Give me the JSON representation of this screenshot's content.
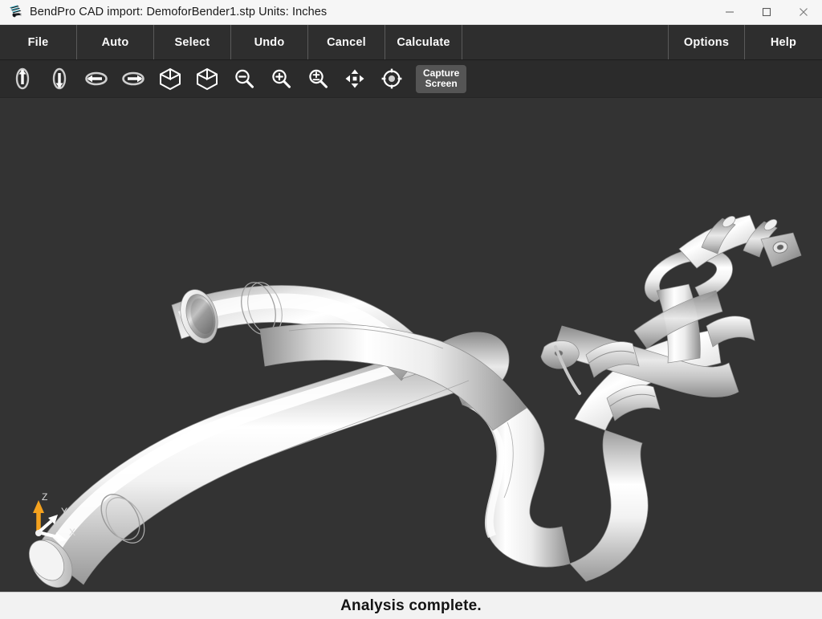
{
  "window": {
    "app_icon": "pipe-logo-icon",
    "title": "BendPro CAD import: DemoforBender1.stp  Units: Inches",
    "app_name": "BendPro",
    "document_name": "DemoforBender1.stp",
    "units_label": "Units: Inches",
    "controls": [
      {
        "name": "minimize",
        "icon": "minimize-icon",
        "glyph": "—"
      },
      {
        "name": "maximize",
        "icon": "maximize-icon",
        "glyph": "☐"
      },
      {
        "name": "close",
        "icon": "close-icon",
        "glyph": "✕"
      }
    ]
  },
  "menubar": {
    "left_items": [
      {
        "label": "File",
        "name": "file"
      },
      {
        "label": "Auto",
        "name": "auto"
      },
      {
        "label": "Select",
        "name": "select"
      },
      {
        "label": "Undo",
        "name": "undo"
      },
      {
        "label": "Cancel",
        "name": "cancel"
      },
      {
        "label": "Calculate",
        "name": "calculate"
      }
    ],
    "right_items": [
      {
        "label": "Options",
        "name": "options"
      },
      {
        "label": "Help",
        "name": "help"
      }
    ]
  },
  "toolbar": {
    "buttons": [
      {
        "name": "rotate-left-vertical-axis",
        "icon": "rotate-vertical-ccw-icon",
        "tooltip": "Rotate left"
      },
      {
        "name": "rotate-right-vertical-axis",
        "icon": "rotate-vertical-cw-icon",
        "tooltip": "Rotate right"
      },
      {
        "name": "rotate-horizontal-ccw",
        "icon": "rotate-horizontal-ccw-icon",
        "tooltip": "Rotate counter-clockwise"
      },
      {
        "name": "rotate-horizontal-cw",
        "icon": "rotate-horizontal-cw-icon",
        "tooltip": "Rotate clockwise"
      },
      {
        "name": "view-isometric-left",
        "icon": "cube-left-icon",
        "tooltip": "Isometric view"
      },
      {
        "name": "view-isometric-right",
        "icon": "cube-right-icon",
        "tooltip": "Isometric view"
      },
      {
        "name": "zoom-out",
        "icon": "magnifier-minus-icon",
        "tooltip": "Zoom out"
      },
      {
        "name": "zoom-in",
        "icon": "magnifier-plus-icon",
        "tooltip": "Zoom in"
      },
      {
        "name": "zoom-fit",
        "icon": "magnifier-plusminus-icon",
        "tooltip": "Zoom to fit"
      },
      {
        "name": "pan",
        "icon": "four-way-arrows-icon",
        "tooltip": "Pan"
      },
      {
        "name": "center-view",
        "icon": "target-crosshair-icon",
        "tooltip": "Center view"
      }
    ],
    "capture_label": "Capture\nScreen",
    "capture_line1": "Capture",
    "capture_line2": "Screen"
  },
  "viewport": {
    "background_color": "#333333",
    "model_name": "bent-tube-assembly",
    "axis_gizmo": {
      "name": "axis-orientation-gizmo",
      "axes": [
        {
          "label": "Z",
          "color": "#f5a21e"
        },
        {
          "label": "Y",
          "color": "#ffffff"
        },
        {
          "label": "X",
          "color": "#ffffff"
        }
      ]
    }
  },
  "statusbar": {
    "message": "Analysis complete."
  }
}
